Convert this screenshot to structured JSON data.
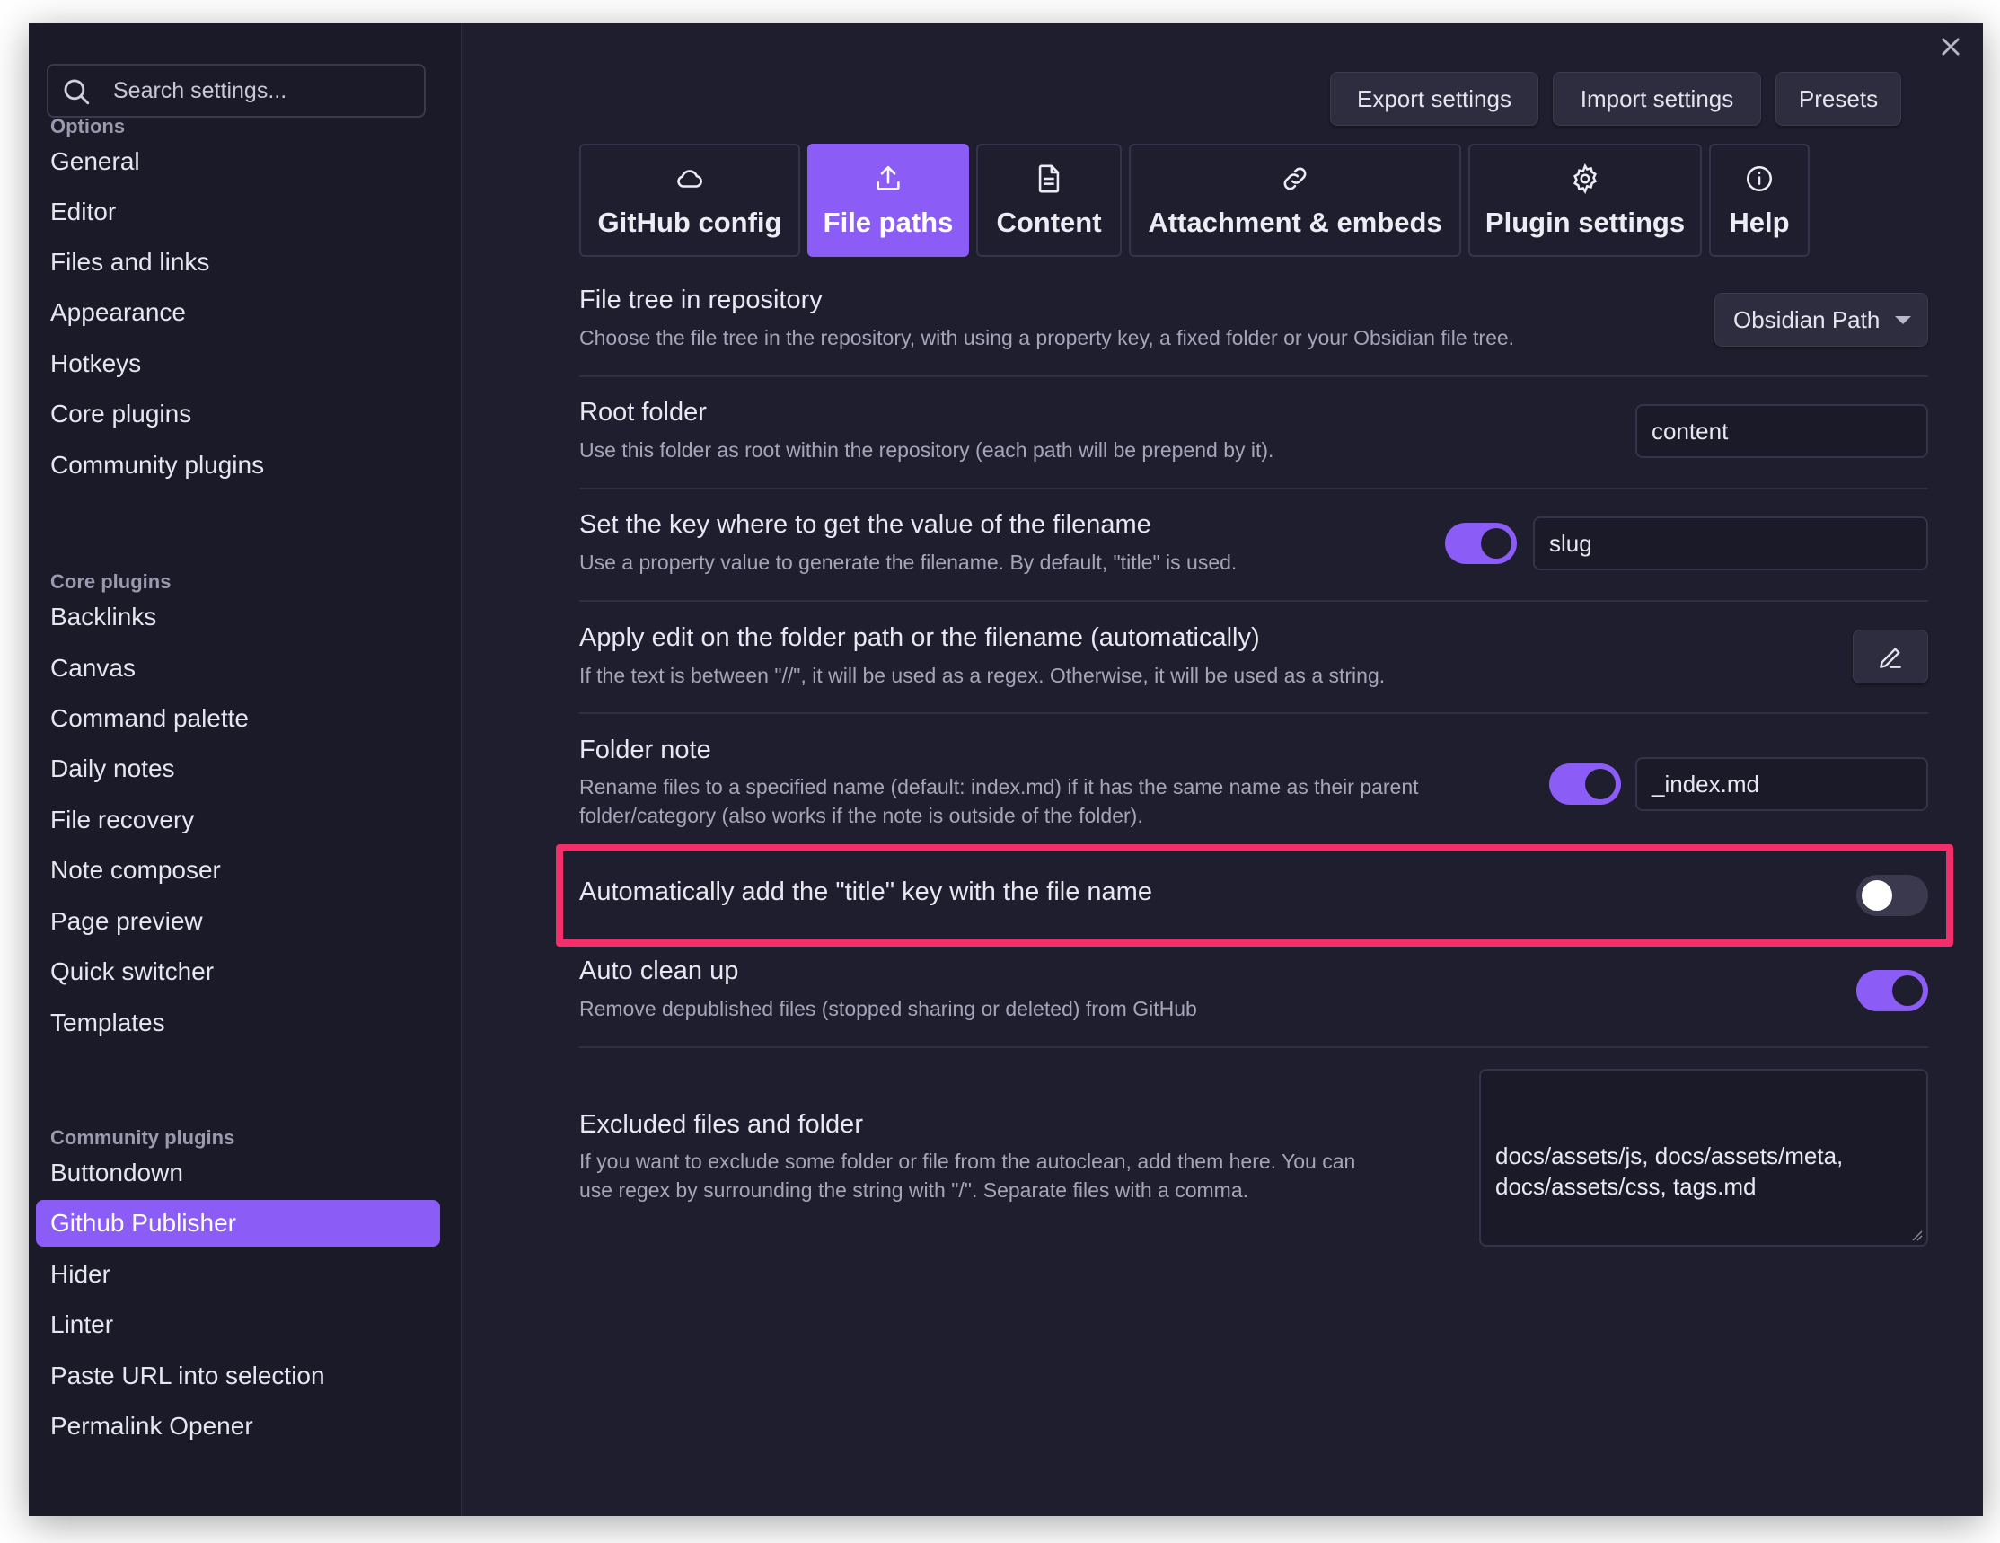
{
  "sidebar": {
    "search_placeholder": "Search settings...",
    "sections": [
      {
        "heading": "Options",
        "items": [
          "General",
          "Editor",
          "Files and links",
          "Appearance",
          "Hotkeys",
          "Core plugins",
          "Community plugins"
        ]
      },
      {
        "heading": "Core plugins",
        "items": [
          "Backlinks",
          "Canvas",
          "Command palette",
          "Daily notes",
          "File recovery",
          "Note composer",
          "Page preview",
          "Quick switcher",
          "Templates"
        ]
      },
      {
        "heading": "Community plugins",
        "items": [
          "Buttondown",
          "Github Publisher",
          "Hider",
          "Linter",
          "Paste URL into selection",
          "Permalink Opener"
        ]
      }
    ],
    "active_item": "Github Publisher"
  },
  "header": {
    "export_label": "Export settings",
    "import_label": "Import settings",
    "presets_label": "Presets",
    "close_icon": "close-icon"
  },
  "tabs": [
    {
      "label": "GitHub config",
      "icon": "cloud-icon"
    },
    {
      "label": "File paths",
      "icon": "upload-icon",
      "active": true
    },
    {
      "label": "Content",
      "icon": "document-icon"
    },
    {
      "label": "Attachment & embeds",
      "icon": "link-icon"
    },
    {
      "label": "Plugin settings",
      "icon": "gear-icon"
    },
    {
      "label": "Help",
      "icon": "info-icon"
    }
  ],
  "settings": {
    "file_tree": {
      "title": "File tree in repository",
      "desc": "Choose the file tree in the repository, with using a property key, a fixed folder or your Obsidian file tree.",
      "value": "Obsidian Path"
    },
    "root_folder": {
      "title": "Root folder",
      "desc": "Use this folder as root within the repository (each path will be prepend by it).",
      "value": "content"
    },
    "filename_key": {
      "title": "Set the key where to get the value of the filename",
      "desc": "Use a property value to generate the filename. By default, \"title\" is used.",
      "enabled": true,
      "value": "slug"
    },
    "apply_edit": {
      "title": "Apply edit on the folder path or the filename (automatically)",
      "desc": "If the text is between \"//\", it will be used as a regex. Otherwise, it will be used as a string."
    },
    "folder_note": {
      "title": "Folder note",
      "desc_line1": "Rename files to a specified name (default: index.md) if it has the same name as their parent",
      "desc_line2": "folder/category (also works if the note is outside of the folder).",
      "enabled": true,
      "value": "_index.md"
    },
    "auto_title": {
      "title": "Automatically add the \"title\" key with the file name",
      "enabled": false
    },
    "auto_clean": {
      "title": "Auto clean up",
      "desc": "Remove depublished files (stopped sharing or deleted) from GitHub",
      "enabled": true
    },
    "excluded": {
      "title": "Excluded files and folder",
      "desc_line1": "If you want to exclude some folder or file from the autoclean, add them here. You can",
      "desc_line2": "use regex by surrounding the string with \"/\". Separate files with a comma.",
      "value": "docs/assets/js, docs/assets/meta,\ndocs/assets/css, tags.md"
    }
  },
  "colors": {
    "accent": "#8b5cf6",
    "highlight": "#f42e6a",
    "background": "#1f1e2e"
  }
}
